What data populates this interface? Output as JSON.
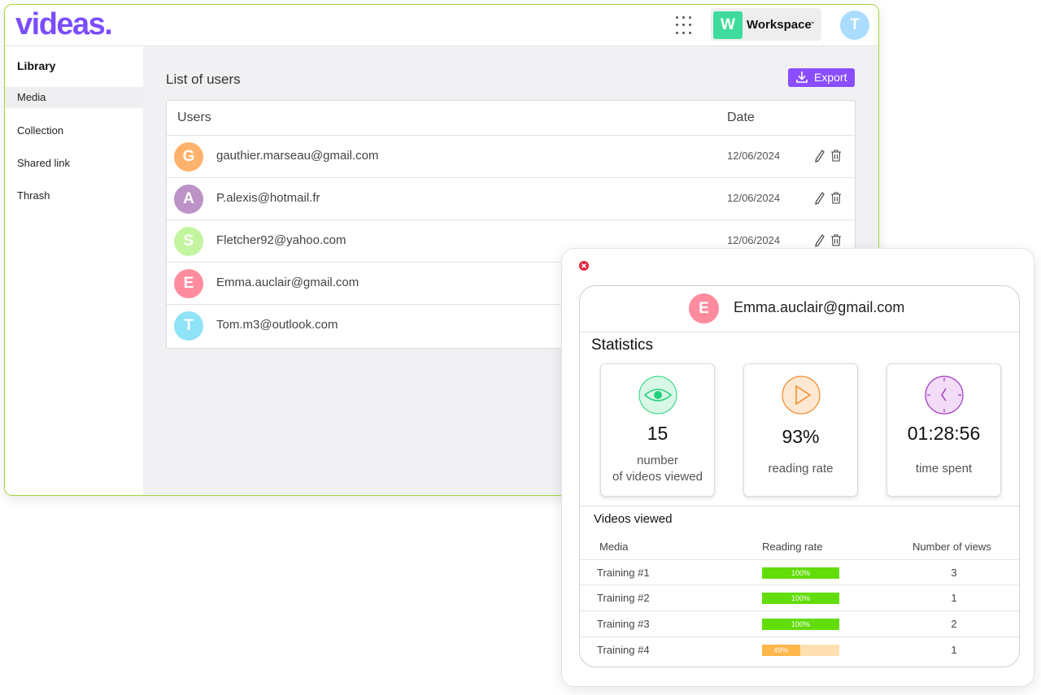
{
  "app": {
    "logo": "videas.",
    "workspace": {
      "badge": "W",
      "name": "Workspace",
      "chevron": "⌄"
    },
    "user_avatar": "T"
  },
  "sidebar": {
    "title": "Library",
    "items": [
      {
        "label": "Media",
        "active": true
      },
      {
        "label": "Collection"
      },
      {
        "label": "Shared link"
      },
      {
        "label": "Thrash"
      }
    ]
  },
  "main": {
    "title": "List of users",
    "export_label": "Export",
    "columns": {
      "users": "Users",
      "date": "Date"
    },
    "rows": [
      {
        "initial": "G",
        "color": "#ffb26b",
        "email": "gauthier.marseau@gmail.com",
        "date": "12/06/2024"
      },
      {
        "initial": "A",
        "color": "#bc93c6",
        "email": "P.alexis@hotmail.fr",
        "date": "12/06/2024"
      },
      {
        "initial": "S",
        "color": "#c3f5a0",
        "email": "Fletcher92@yahoo.com",
        "date": "12/06/2024"
      },
      {
        "initial": "E",
        "color": "#ff8c9e",
        "email": "Emma.auclair@gmail.com",
        "date": ""
      },
      {
        "initial": "T",
        "color": "#8fe3f7",
        "email": "Tom.m3@outlook.com",
        "date": ""
      }
    ]
  },
  "panel": {
    "user": {
      "initial": "E",
      "email": "Emma.auclair@gmail.com"
    },
    "stats_title": "Statistics",
    "cards": [
      {
        "icon": "eye-icon",
        "color": "#22d27a",
        "value": "15",
        "label_line1": "number",
        "label_line2": "of videos viewed"
      },
      {
        "icon": "play-icon",
        "color": "#f08a2a",
        "value": "93%",
        "label_line1": "reading rate"
      },
      {
        "icon": "clock-icon",
        "color": "#a033c4",
        "value": "01:28:56",
        "label_line1": "time spent"
      }
    ],
    "videos_title": "Videos viewed",
    "headers": {
      "media": "Media",
      "rate": "Reading rate",
      "views": "Number of views"
    },
    "videos": [
      {
        "name": "Training #1",
        "rate": 1.0,
        "rate_label": "100%",
        "views": "3"
      },
      {
        "name": "Training #2",
        "rate": 1.0,
        "rate_label": "100%",
        "views": "1"
      },
      {
        "name": "Training #3",
        "rate": 1.0,
        "rate_label": "100%",
        "views": "2"
      },
      {
        "name": "Training #4",
        "rate": 0.49,
        "rate_label": "49%",
        "views": "1"
      }
    ],
    "colors": {
      "full": "#62dd0a",
      "partial": "#ffb64a",
      "partial_track": "#ffe0b0"
    }
  }
}
